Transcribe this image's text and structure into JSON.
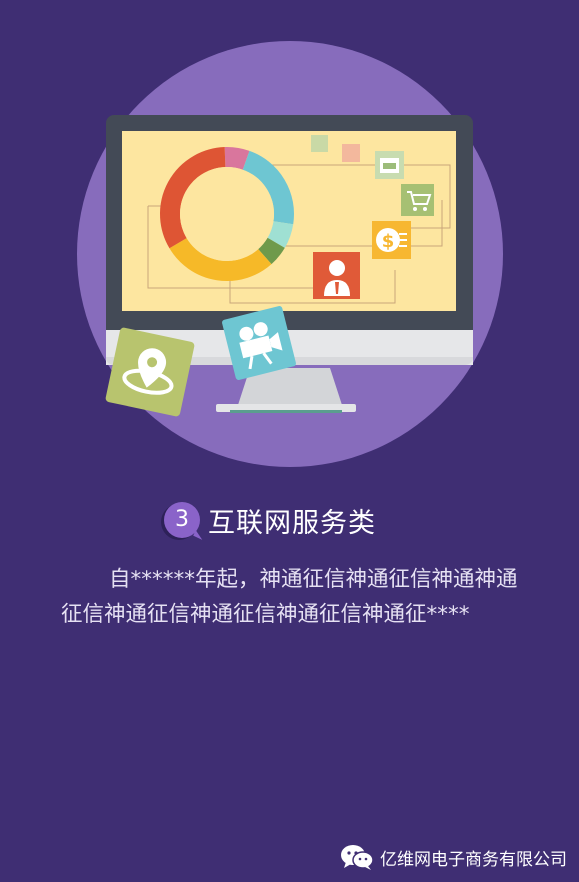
{
  "section": {
    "number": "3",
    "title": "互联网服务类"
  },
  "body_text": "自******年起，神通征信神通征信神通神通征信神通征信神通征信神通征信神通征****",
  "footer": {
    "account_name": "亿维网电子商务有限公司",
    "icon": "wechat-icon"
  },
  "colors": {
    "background": "#3f2e73",
    "circle": "#876cbc",
    "screen": "#fde6a0",
    "accent": "#8a63c9"
  },
  "chart_data": {
    "type": "pie",
    "categories": [
      "pink",
      "blue",
      "mint",
      "green",
      "yellow",
      "red"
    ],
    "values": [
      6,
      22,
      6,
      5,
      28,
      33
    ],
    "donut": true
  }
}
